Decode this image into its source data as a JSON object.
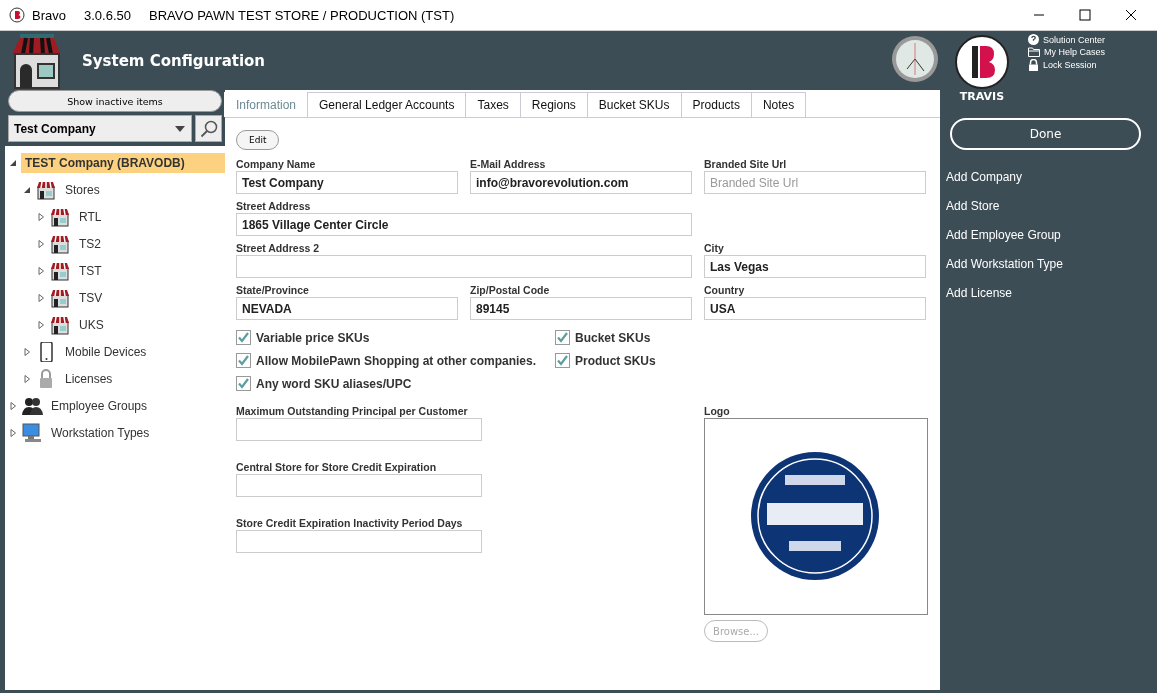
{
  "window": {
    "app": "Bravo",
    "version": "3.0.6.50",
    "title": "BRAVO PAWN TEST STORE / PRODUCTION (TST)"
  },
  "header": {
    "title": "System Configuration",
    "user": "TRAVIS",
    "links": [
      {
        "label": "Solution Center",
        "kind": "help"
      },
      {
        "label": "My Help Cases",
        "kind": "folder"
      },
      {
        "label": "Lock Session",
        "kind": "lock"
      }
    ]
  },
  "sidebar": {
    "show_inactive": "Show inactive items",
    "company": "Test Company",
    "tree": [
      {
        "label": "TEST Company (BRAVODB)",
        "kind": "root",
        "expanded": true,
        "selected": true,
        "children": [
          {
            "label": "Stores",
            "kind": "store",
            "expanded": true,
            "selected": false,
            "children": [
              {
                "label": "RTL",
                "kind": "store",
                "expanded": false,
                "selected": false
              },
              {
                "label": "TS2",
                "kind": "store",
                "expanded": false,
                "selected": false
              },
              {
                "label": "TST",
                "kind": "store",
                "expanded": false,
                "selected": false
              },
              {
                "label": "TSV",
                "kind": "store",
                "expanded": false,
                "selected": false
              },
              {
                "label": "UKS",
                "kind": "store",
                "expanded": false,
                "selected": false
              }
            ]
          },
          {
            "label": "Mobile Devices",
            "kind": "phone",
            "expanded": false,
            "selected": false
          },
          {
            "label": "Licenses",
            "kind": "lock",
            "expanded": false,
            "selected": false
          }
        ]
      },
      {
        "label": "Employee Groups",
        "kind": "people",
        "expanded": false,
        "selected": false
      },
      {
        "label": "Workstation Types",
        "kind": "computer",
        "expanded": false,
        "selected": false
      }
    ]
  },
  "tabs": [
    {
      "label": "Information",
      "selected": true
    },
    {
      "label": "General Ledger Accounts",
      "selected": false
    },
    {
      "label": "Taxes",
      "selected": false
    },
    {
      "label": "Regions",
      "selected": false
    },
    {
      "label": "Bucket SKUs",
      "selected": false
    },
    {
      "label": "Products",
      "selected": false
    },
    {
      "label": "Notes",
      "selected": false
    }
  ],
  "form": {
    "edit": "Edit",
    "fields": [
      {
        "label": "Company Name",
        "value": "Test Company",
        "kind": "text"
      },
      {
        "label": "E-Mail Address",
        "value": "info@bravorevolution.com",
        "kind": "text"
      },
      {
        "label": "Branded Site Url",
        "placeholder": "Branded Site Url",
        "kind": "text"
      },
      {
        "label": "Street Address",
        "value": "1865 Village Center Circle",
        "kind": "wide"
      },
      {
        "label": "Street Address 2",
        "kind": "wide"
      },
      {
        "label": "City",
        "value": "Las Vegas",
        "kind": "text"
      },
      {
        "label": "State/Province",
        "value": "NEVADA",
        "kind": "text"
      },
      {
        "label": "Zip/Postal Code",
        "value": "89145",
        "kind": "text"
      },
      {
        "label": "Country",
        "value": "USA",
        "kind": "text"
      }
    ],
    "checkboxes": [
      {
        "label": "Variable price SKUs",
        "checked": true
      },
      {
        "label": "Bucket SKUs",
        "checked": true
      },
      {
        "label": "Allow MobilePawn Shopping at other companies.",
        "checked": true
      },
      {
        "label": "Product SKUs",
        "checked": true
      },
      {
        "label": "Any word SKU aliases/UPC",
        "checked": true
      }
    ],
    "extra_fields": [
      {
        "label": "Maximum Outstanding Principal per Customer"
      },
      {
        "label": "Central Store for Store Credit Expiration"
      },
      {
        "label": "Store Credit Expiration Inactivity Period Days"
      }
    ],
    "logo": {
      "label": "Logo",
      "browse": "Browse...",
      "browse_disabled": true
    }
  },
  "actions": {
    "done": "Done",
    "items": [
      "Add Company",
      "Add Store",
      "Add Employee Group",
      "Add Workstation Type",
      "Add License"
    ]
  }
}
